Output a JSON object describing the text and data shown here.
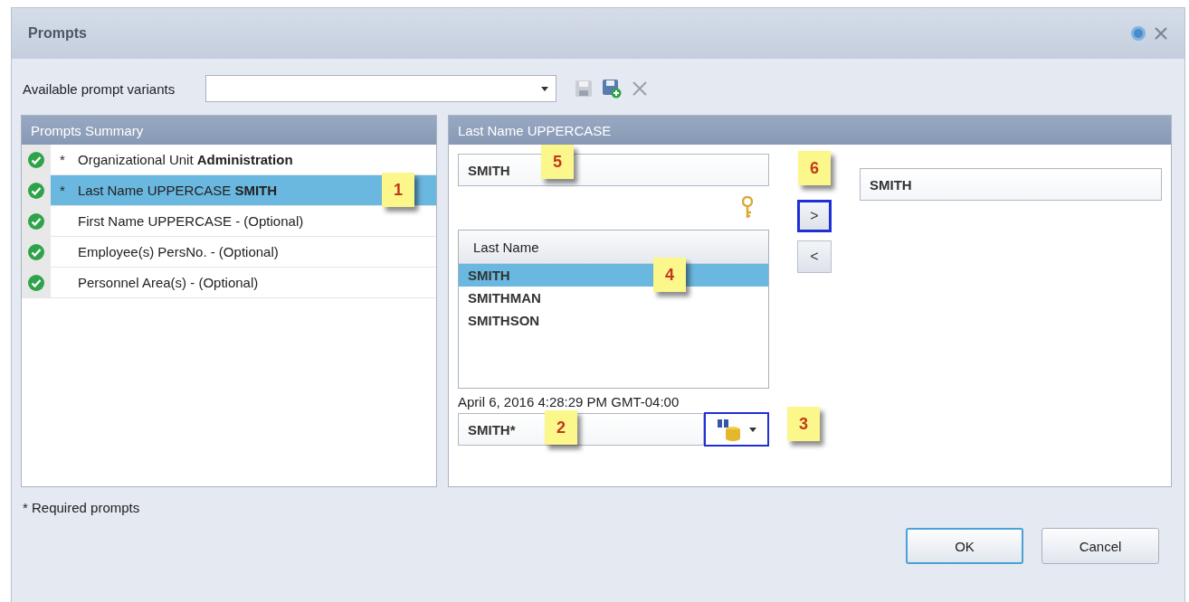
{
  "dialog": {
    "title": "Prompts"
  },
  "variants": {
    "label": "Available prompt variants"
  },
  "summary": {
    "title": "Prompts Summary",
    "items": [
      {
        "marker": "*",
        "text": "Organizational Unit **Administration**",
        "selected": false,
        "valid": true
      },
      {
        "marker": "*",
        "text": "Last Name UPPERCASE **SMITH**",
        "selected": true,
        "valid": true,
        "callout": "1"
      },
      {
        "text": "First Name UPPERCASE - (Optional)",
        "selected": false,
        "valid": true
      },
      {
        "text": "Employee(s) PersNo. - (Optional)",
        "selected": false,
        "valid": true
      },
      {
        "text": "Personnel Area(s) - (Optional)",
        "selected": false,
        "valid": true
      }
    ]
  },
  "detail": {
    "title": "Last Name UPPERCASE",
    "search": {
      "value": "SMITH",
      "callout": "5"
    },
    "list": {
      "header": "Last Name",
      "rows": [
        {
          "text": "SMITH",
          "selected": true,
          "callout": "4"
        },
        {
          "text": "SMITHMAN",
          "selected": false
        },
        {
          "text": "SMITHSON",
          "selected": false
        }
      ]
    },
    "timestamp": "April 6, 2016 4:28:29 PM GMT-04:00",
    "filter": {
      "value": "SMITH*",
      "callout": "2"
    },
    "search_button": {
      "highlighted": true,
      "callout": "3"
    },
    "move_buttons": [
      {
        "label": ">",
        "highlighted": true,
        "callout": "6"
      },
      {
        "label": "<",
        "highlighted": false
      }
    ],
    "selected_values": [
      "SMITH"
    ]
  },
  "footer": {
    "note": "* Required prompts",
    "buttons": [
      {
        "label": "OK",
        "default": true
      },
      {
        "label": "Cancel",
        "default": false
      }
    ]
  }
}
